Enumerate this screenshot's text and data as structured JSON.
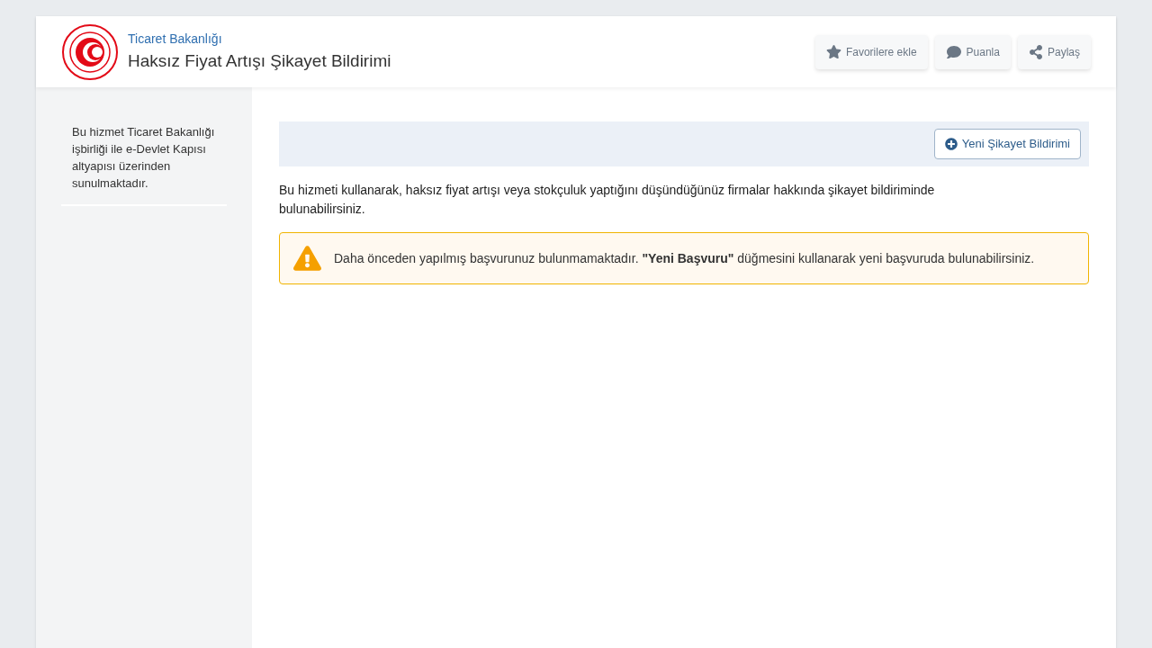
{
  "header": {
    "ministry": "Ticaret Bakanlığı",
    "title": "Haksız Fiyat Artışı Şikayet Bildirimi",
    "actions": [
      {
        "kind": "favorite",
        "label": "Favorilere ekle"
      },
      {
        "kind": "rate",
        "label": "Puanla"
      },
      {
        "kind": "share",
        "label": "Paylaş"
      }
    ]
  },
  "sidebar": {
    "note": "Bu hizmet Ticaret Bakanlığı işbirliği ile e-Devlet Kapısı altyapısı üzerinden sunulmaktadır."
  },
  "toolbar": {
    "button": "Yeni Şikayet Bildirimi"
  },
  "intro": "Bu hizmeti kullanarak, haksız fiyat artışı veya stokçuluk yaptığını düşündüğünüz firmalar hakkında şikayet bildiriminde bulunabilirsiniz.",
  "alert": {
    "kind": "warning",
    "text": "Daha önceden yapılmış başvurunuz bulunmamaktadır. **\"Yeni Başvuru\"** düğmesini kullanarak yeni başvuruda bulunabilirsiniz."
  }
}
